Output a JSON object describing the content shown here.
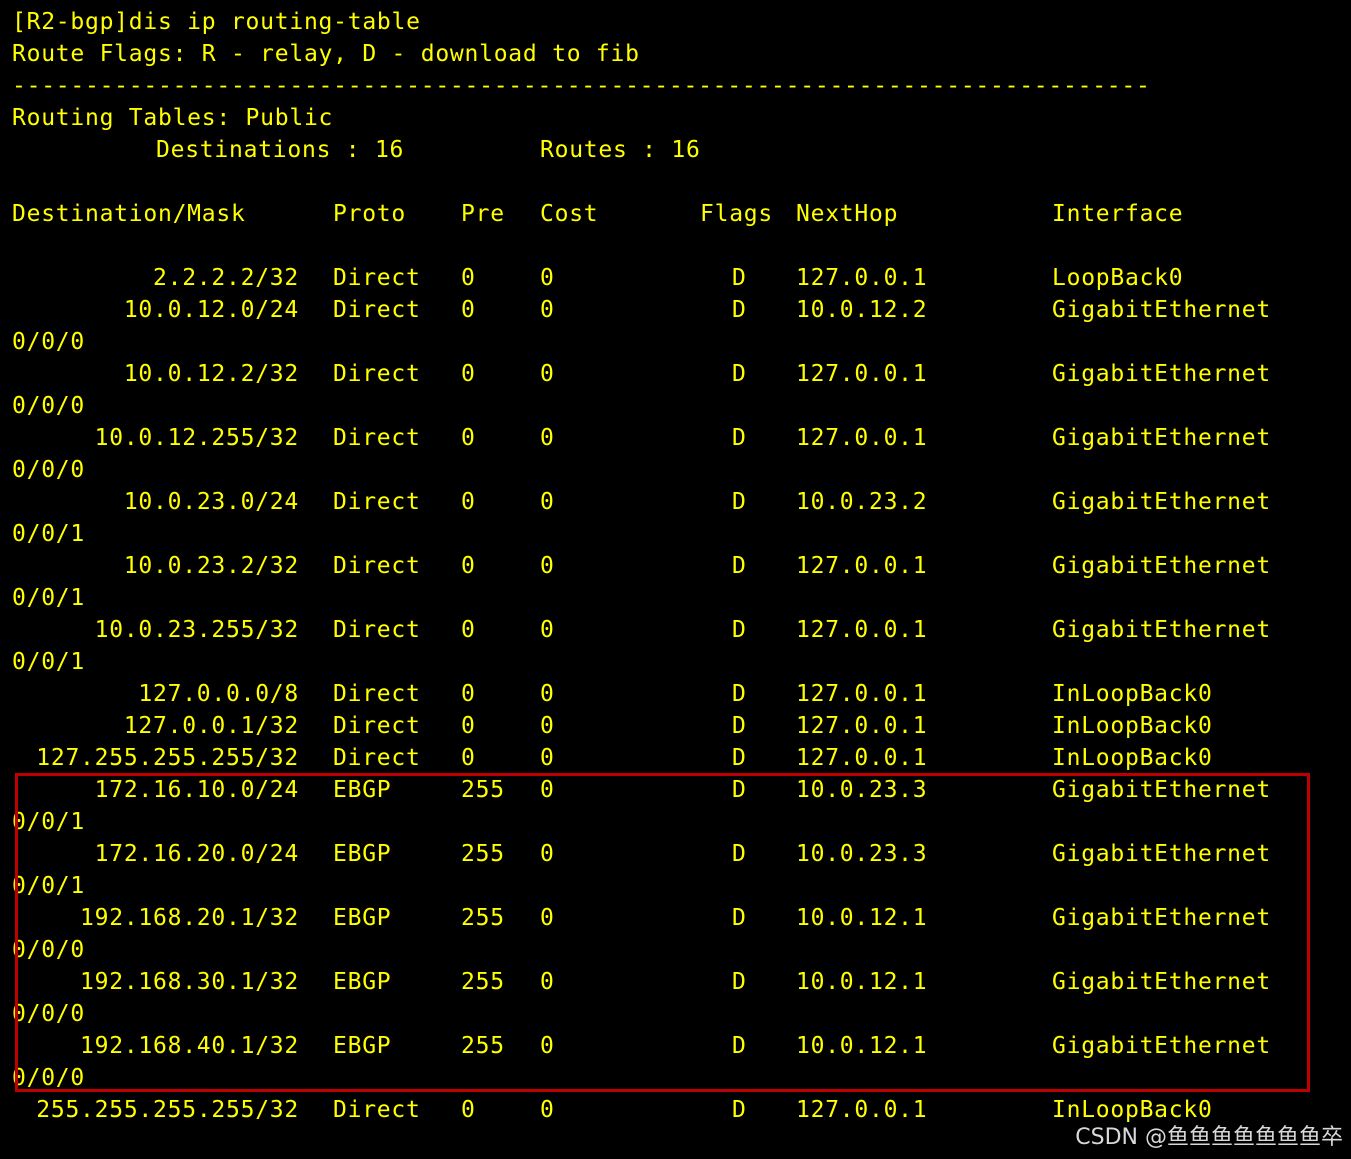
{
  "terminal": {
    "command": "[R2-bgp]dis ip routing-table",
    "flags_legend": "Route Flags: R - relay, D - download to fib",
    "separator": "------------------------------------------------------------------------------",
    "table_name": "Routing Tables: Public",
    "destinations_label": "Destinations : 16",
    "routes_label": "Routes : 16",
    "columns": {
      "destination": "Destination/Mask",
      "proto": "Proto",
      "pre": "Pre",
      "cost": "Cost",
      "flags": "Flags",
      "nexthop": "NextHop",
      "interface": "Interface"
    },
    "routes": [
      {
        "dest": "2.2.2.2/32",
        "proto": "Direct",
        "pre": "0",
        "cost": "0",
        "flags": "D",
        "nexthop": "127.0.0.1",
        "iface": "LoopBack0",
        "iface_cont": ""
      },
      {
        "dest": "10.0.12.0/24",
        "proto": "Direct",
        "pre": "0",
        "cost": "0",
        "flags": "D",
        "nexthop": "10.0.12.2",
        "iface": "GigabitEthernet",
        "iface_cont": "0/0/0"
      },
      {
        "dest": "10.0.12.2/32",
        "proto": "Direct",
        "pre": "0",
        "cost": "0",
        "flags": "D",
        "nexthop": "127.0.0.1",
        "iface": "GigabitEthernet",
        "iface_cont": "0/0/0"
      },
      {
        "dest": "10.0.12.255/32",
        "proto": "Direct",
        "pre": "0",
        "cost": "0",
        "flags": "D",
        "nexthop": "127.0.0.1",
        "iface": "GigabitEthernet",
        "iface_cont": "0/0/0"
      },
      {
        "dest": "10.0.23.0/24",
        "proto": "Direct",
        "pre": "0",
        "cost": "0",
        "flags": "D",
        "nexthop": "10.0.23.2",
        "iface": "GigabitEthernet",
        "iface_cont": "0/0/1"
      },
      {
        "dest": "10.0.23.2/32",
        "proto": "Direct",
        "pre": "0",
        "cost": "0",
        "flags": "D",
        "nexthop": "127.0.0.1",
        "iface": "GigabitEthernet",
        "iface_cont": "0/0/1"
      },
      {
        "dest": "10.0.23.255/32",
        "proto": "Direct",
        "pre": "0",
        "cost": "0",
        "flags": "D",
        "nexthop": "127.0.0.1",
        "iface": "GigabitEthernet",
        "iface_cont": "0/0/1"
      },
      {
        "dest": "127.0.0.0/8",
        "proto": "Direct",
        "pre": "0",
        "cost": "0",
        "flags": "D",
        "nexthop": "127.0.0.1",
        "iface": "InLoopBack0",
        "iface_cont": ""
      },
      {
        "dest": "127.0.0.1/32",
        "proto": "Direct",
        "pre": "0",
        "cost": "0",
        "flags": "D",
        "nexthop": "127.0.0.1",
        "iface": "InLoopBack0",
        "iface_cont": ""
      },
      {
        "dest": "127.255.255.255/32",
        "proto": "Direct",
        "pre": "0",
        "cost": "0",
        "flags": "D",
        "nexthop": "127.0.0.1",
        "iface": "InLoopBack0",
        "iface_cont": ""
      },
      {
        "dest": "172.16.10.0/24",
        "proto": "EBGP",
        "pre": "255",
        "cost": "0",
        "flags": "D",
        "nexthop": "10.0.23.3",
        "iface": "GigabitEthernet",
        "iface_cont": "0/0/1"
      },
      {
        "dest": "172.16.20.0/24",
        "proto": "EBGP",
        "pre": "255",
        "cost": "0",
        "flags": "D",
        "nexthop": "10.0.23.3",
        "iface": "GigabitEthernet",
        "iface_cont": "0/0/1"
      },
      {
        "dest": "192.168.20.1/32",
        "proto": "EBGP",
        "pre": "255",
        "cost": "0",
        "flags": "D",
        "nexthop": "10.0.12.1",
        "iface": "GigabitEthernet",
        "iface_cont": "0/0/0"
      },
      {
        "dest": "192.168.30.1/32",
        "proto": "EBGP",
        "pre": "255",
        "cost": "0",
        "flags": "D",
        "nexthop": "10.0.12.1",
        "iface": "GigabitEthernet",
        "iface_cont": "0/0/0"
      },
      {
        "dest": "192.168.40.1/32",
        "proto": "EBGP",
        "pre": "255",
        "cost": "0",
        "flags": "D",
        "nexthop": "10.0.12.1",
        "iface": "GigabitEthernet",
        "iface_cont": "0/0/0"
      },
      {
        "dest": "255.255.255.255/32",
        "proto": "Direct",
        "pre": "0",
        "cost": "0",
        "flags": "D",
        "nexthop": "127.0.0.1",
        "iface": "InLoopBack0",
        "iface_cont": ""
      }
    ]
  },
  "watermark": "CSDN @鱼鱼鱼鱼鱼鱼鱼卒",
  "colors": {
    "background": "#000000",
    "text": "#ffff00",
    "highlight": "#c00000"
  }
}
